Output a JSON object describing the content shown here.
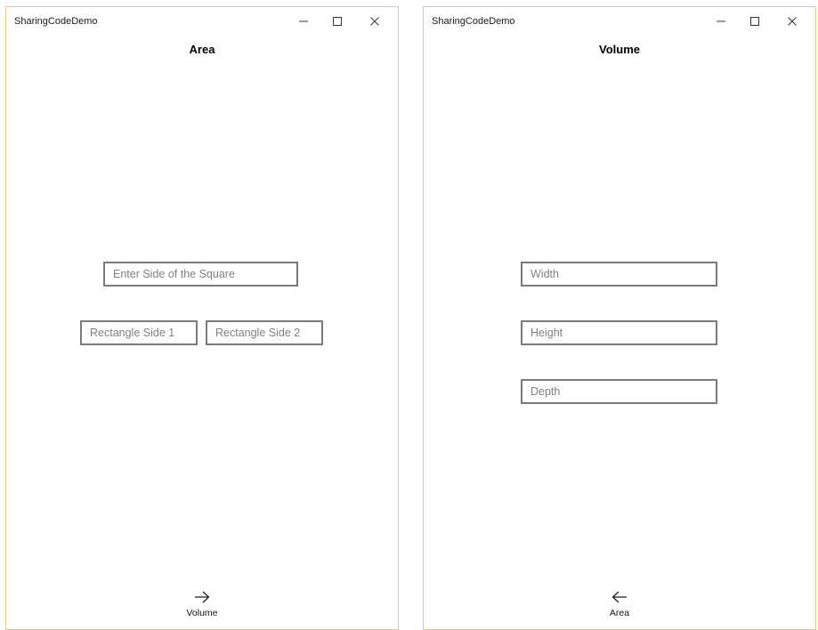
{
  "area_window": {
    "app_title": "SharingCodeDemo",
    "page_title": "Area",
    "square_input": {
      "placeholder": "Enter Side of the Square",
      "value": ""
    },
    "rect_side1_input": {
      "placeholder": "Rectangle Side 1",
      "value": ""
    },
    "rect_side2_input": {
      "placeholder": "Rectangle Side 2",
      "value": ""
    },
    "nav": {
      "label": "Volume",
      "icon": "arrow-right-icon"
    }
  },
  "volume_window": {
    "app_title": "SharingCodeDemo",
    "page_title": "Volume",
    "width_input": {
      "placeholder": "Width",
      "value": ""
    },
    "height_input": {
      "placeholder": "Height",
      "value": ""
    },
    "depth_input": {
      "placeholder": "Depth",
      "value": ""
    },
    "nav": {
      "label": "Area",
      "icon": "arrow-left-icon"
    }
  },
  "caption_icons": [
    "minimize-icon",
    "maximize-icon",
    "close-icon"
  ],
  "colors": {
    "window_border": "#e6c98a",
    "input_border": "#7a7a7a",
    "placeholder": "#808080"
  }
}
